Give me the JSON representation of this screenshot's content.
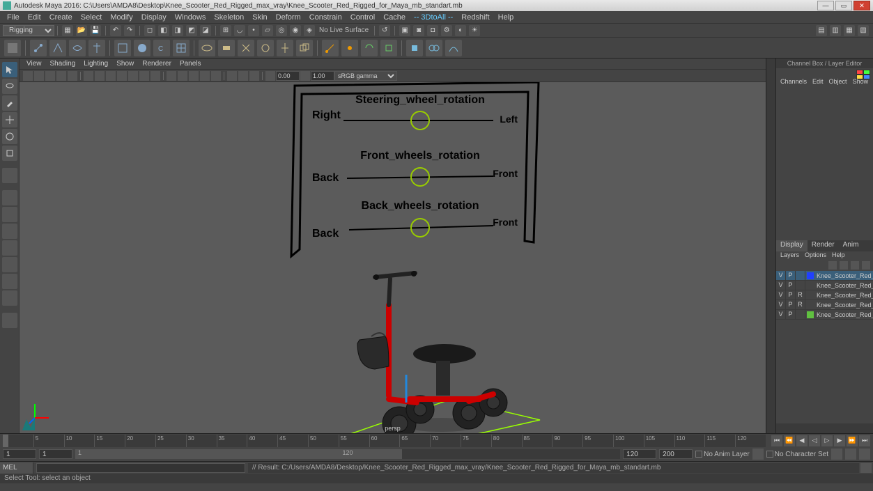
{
  "title": "Autodesk Maya 2016: C:\\Users\\AMDA8\\Desktop\\Knee_Scooter_Red_Rigged_max_vray\\Knee_Scooter_Red_Rigged_for_Maya_mb_standart.mb",
  "mainmenu": [
    "File",
    "Edit",
    "Create",
    "Select",
    "Modify",
    "Display",
    "Windows",
    "Skeleton",
    "Skin",
    "Deform",
    "Constrain",
    "Control",
    "Cache",
    "-- 3DtoAll --",
    "Redshift",
    "Help"
  ],
  "modeset": "Rigging",
  "nolive": "No Live Surface",
  "panelmenu": [
    "View",
    "Shading",
    "Lighting",
    "Show",
    "Renderer",
    "Panels"
  ],
  "panelnums": {
    "a": "0.00",
    "b": "1.00"
  },
  "gamma": "sRGB gamma",
  "viewlabel": "persp",
  "hud": {
    "slider1": {
      "title": "Steering_wheel_rotation",
      "left": "Right",
      "right": "Left"
    },
    "slider2": {
      "title": "Front_wheels_rotation",
      "left": "Back",
      "right": "Front"
    },
    "slider3": {
      "title": "Back_wheels_rotation",
      "left": "Back",
      "right": "Front"
    }
  },
  "channelbox": {
    "title": "Channel Box / Layer Editor",
    "menu": [
      "Channels",
      "Edit",
      "Object",
      "Show"
    ]
  },
  "layertabs": [
    "Display",
    "Render",
    "Anim"
  ],
  "layersmenu": [
    "Layers",
    "Options",
    "Help"
  ],
  "layers": [
    {
      "v": "V",
      "p": "P",
      "r": "",
      "color": "#2040ff",
      "name": "Knee_Scooter_Red_Rig",
      "active": true
    },
    {
      "v": "V",
      "p": "P",
      "r": "",
      "color": "",
      "name": "Knee_Scooter_Red_Rig",
      "active": false
    },
    {
      "v": "V",
      "p": "P",
      "r": "R",
      "color": "",
      "name": "Knee_Scooter_Red_Rig",
      "active": false
    },
    {
      "v": "V",
      "p": "P",
      "r": "R",
      "color": "",
      "name": "Knee_Scooter_Red_Rig",
      "active": false
    },
    {
      "v": "V",
      "p": "P",
      "r": "",
      "color": "#60c040",
      "name": "Knee_Scooter_Red_Rig",
      "active": false
    }
  ],
  "timeticks": [
    "1",
    "5",
    "10",
    "15",
    "20",
    "25",
    "30",
    "35",
    "40",
    "45",
    "50",
    "55",
    "60",
    "65",
    "70",
    "75",
    "80",
    "85",
    "90",
    "95",
    "100",
    "105",
    "110",
    "115",
    "120"
  ],
  "range": {
    "startOuter": "1",
    "startInner": "1",
    "startbar": "1",
    "midbar": "120",
    "endInner": "120",
    "endOuter": "200"
  },
  "animlayer": "No Anim Layer",
  "charset": "No Character Set",
  "cmdlang": "MEL",
  "cmdresult": "// Result: C:/Users/AMDA8/Desktop/Knee_Scooter_Red_Rigged_max_vray/Knee_Scooter_Red_Rigged_for_Maya_mb_standart.mb",
  "help": "Select Tool: select an object"
}
